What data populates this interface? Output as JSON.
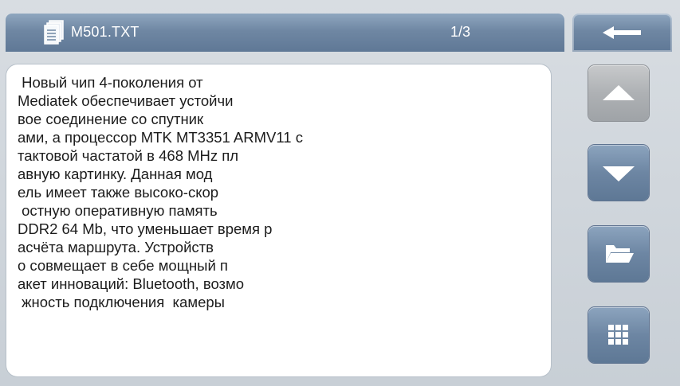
{
  "header": {
    "file_name": "M501.TXT",
    "page_indicator": "1/3"
  },
  "document": {
    "lines": [
      " Новый чип 4-поколения от",
      "Mediatek обеспечивает устойчи",
      "вое соединение со спутник",
      "ами, а процессор MTK MT3351 ARMV11 с",
      "тактовой частатой в 468 MHz пл",
      "авную картинку. Данная мод",
      "ель имеет также высоко-скор",
      " остную оперативную память",
      "DDR2 64 Mb, что уменьшает время р",
      "асчёта маршрута. Устройств",
      "о совмещает в себе мощный п",
      "акет инноваций: Bluetooth, возмо",
      " жность подключения  камеры"
    ]
  },
  "icons": {
    "file": "document-stack-icon",
    "back": "arrow-left-icon",
    "scroll_up": "triangle-up-icon",
    "scroll_down": "triangle-down-icon",
    "folder": "folder-open-icon",
    "grid": "grid-menu-icon"
  },
  "colors": {
    "accent": "#6f87a3",
    "panel": "#ffffff",
    "background": "#cfd5db",
    "disabled": "#aeb1b4"
  }
}
